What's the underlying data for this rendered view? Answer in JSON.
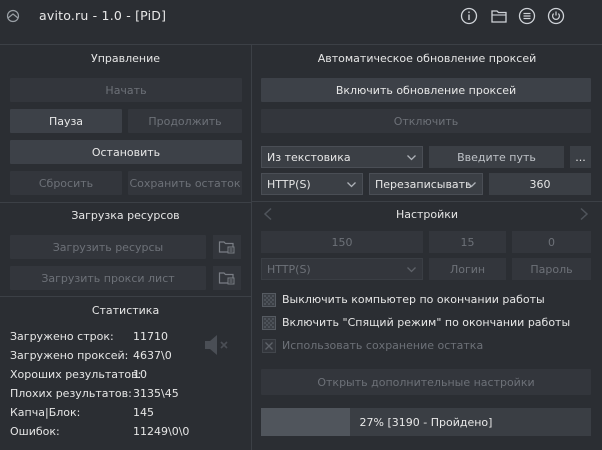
{
  "window": {
    "title": "avito.ru - 1.0 - [PiD]",
    "icons": [
      "info-icon",
      "folder-icon",
      "menu-icon",
      "power-icon"
    ]
  },
  "control": {
    "title": "Управление",
    "start": "Начать",
    "pause": "Пауза",
    "resume": "Продолжить",
    "stop": "Остановить",
    "reset": "Сбросить",
    "save_rest": "Сохранить остаток"
  },
  "resources": {
    "title": "Загрузка ресурсов",
    "load_resources": "Загрузить ресурсы",
    "load_proxy": "Загрузить прокси лист"
  },
  "stats": {
    "title": "Статистика",
    "rows": [
      {
        "label": "Загружено строк:",
        "value": "11710"
      },
      {
        "label": "Загружено проксей:",
        "value": "4637\\0"
      },
      {
        "label": "Хороших результатов:",
        "value": "10"
      },
      {
        "label": "Плохих результатов:",
        "value": "3135\\45"
      },
      {
        "label": "Капча|Блок:",
        "value": "145"
      },
      {
        "label": "Ошибок:",
        "value": "11249\\0\\0"
      }
    ]
  },
  "proxy_update": {
    "title": "Автоматическое обновление проксей",
    "enable": "Включить обновление проксей",
    "disable": "Отключить",
    "source": "Из текстовика",
    "path_placeholder": "Введите путь",
    "browse": "...",
    "protocol": "HTTP(S)",
    "mode": "Перезаписывать",
    "interval": "360"
  },
  "settings": {
    "title": "Настройки",
    "field1": "150",
    "field2": "15",
    "field3": "0",
    "protocol": "HTTP(S)",
    "login_placeholder": "Логин",
    "password_placeholder": "Пароль",
    "options": [
      {
        "label": "Выключить компьютер по окончании работы",
        "enabled": true,
        "checked": false
      },
      {
        "label": "Включить \"Спящий режим\" по окончании работы",
        "enabled": true,
        "checked": false
      },
      {
        "label": "Использовать сохранение остатка",
        "enabled": false,
        "checked": false
      }
    ],
    "more_settings": "Открыть дополнительные настройки"
  },
  "progress": {
    "text": "27% [3190 - Пройдено]",
    "fraction": 0.27
  }
}
